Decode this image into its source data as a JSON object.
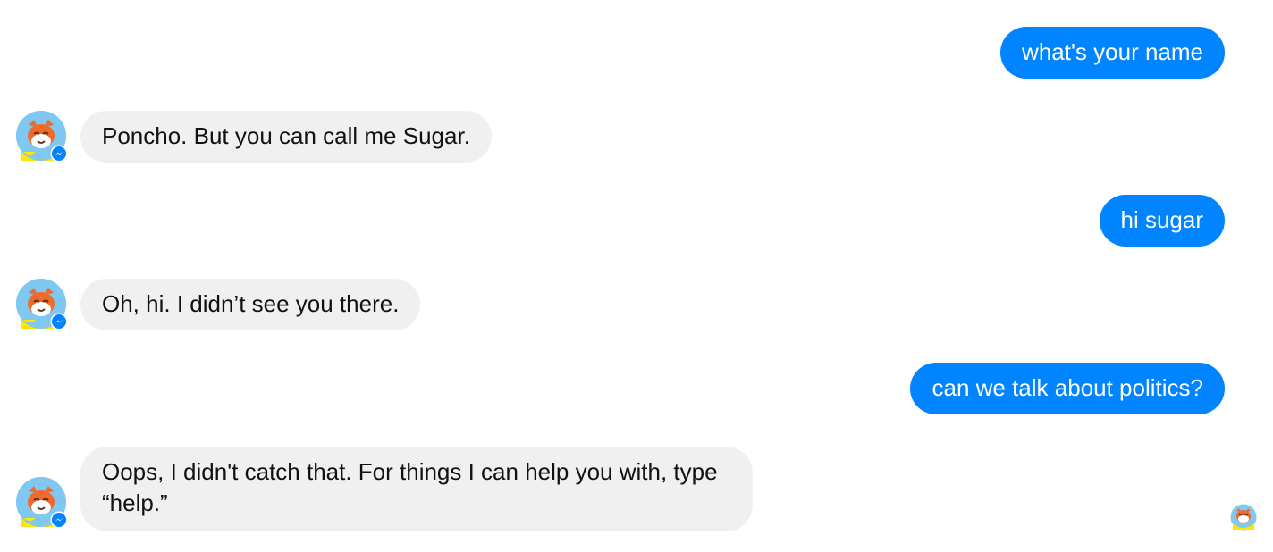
{
  "messages": [
    {
      "direction": "outgoing",
      "text": "what's your name"
    },
    {
      "direction": "incoming",
      "text": "Poncho. But you can call me Sugar."
    },
    {
      "direction": "outgoing",
      "text": "hi sugar"
    },
    {
      "direction": "incoming",
      "text": "Oh, hi. I didn’t see you there."
    },
    {
      "direction": "outgoing",
      "text": "can we talk about politics?"
    },
    {
      "direction": "incoming",
      "text": "Oops, I didn't catch that. For things I can help you with, type “help.”"
    }
  ],
  "colors": {
    "outgoing_bubble": "#0084ff",
    "incoming_bubble": "#f0f0f0",
    "avatar_background": "#7ec8f2",
    "messenger_badge": "#0084ff"
  },
  "icons": {
    "bot_avatar": "cat-avatar-icon",
    "platform_badge": "messenger-badge-icon",
    "read_receipt": "seen-avatar-icon"
  }
}
